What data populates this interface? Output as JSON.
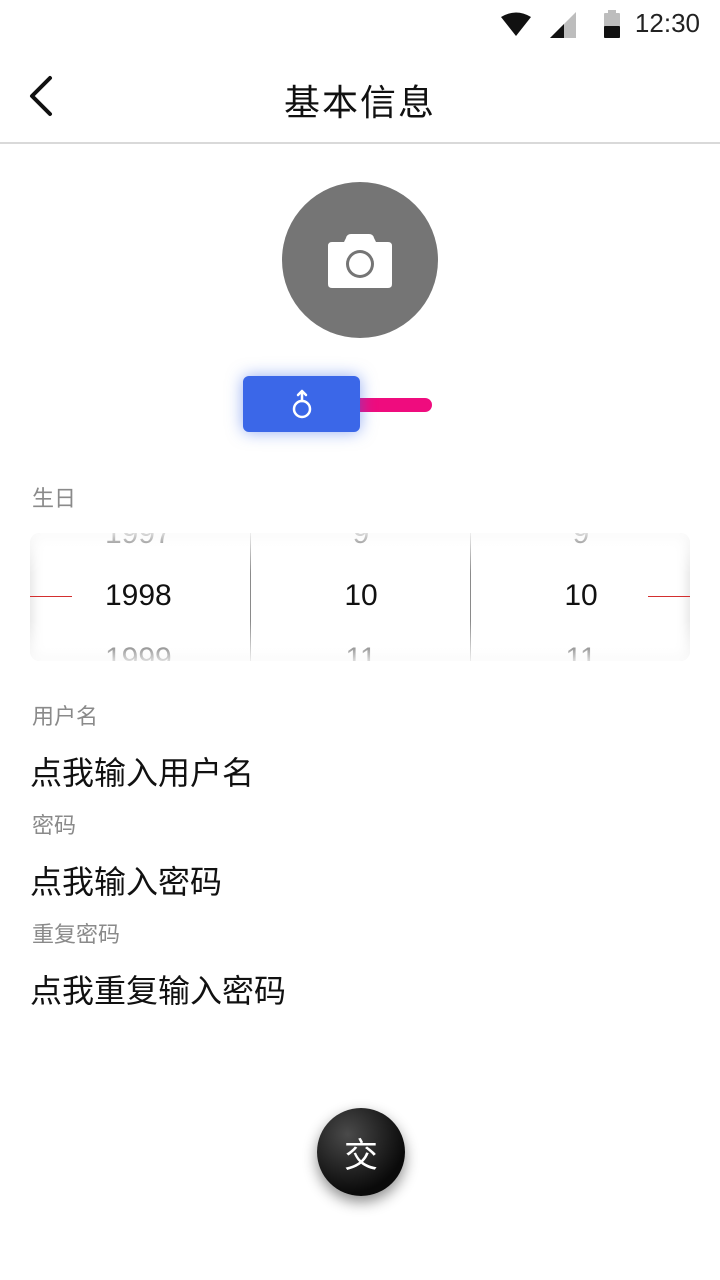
{
  "status_bar": {
    "time": "12:30"
  },
  "header": {
    "title": "基本信息"
  },
  "gender": {
    "male_symbol": "♂"
  },
  "birthday": {
    "label": "生日",
    "year": {
      "prev": "1997",
      "current": "1998",
      "next": "1999"
    },
    "month": {
      "prev": "9",
      "current": "10",
      "next": "11"
    },
    "day": {
      "prev": "9",
      "current": "10",
      "next": "11"
    }
  },
  "username": {
    "label": "用户名",
    "placeholder": "点我输入用户名"
  },
  "password": {
    "label": "密码",
    "placeholder": "点我输入密码"
  },
  "repeat_password": {
    "label": "重复密码",
    "placeholder": "点我重复输入密码"
  },
  "submit": {
    "label": "交"
  },
  "colors": {
    "accent_blue": "#3b67e8",
    "accent_pink": "#ef0c7e",
    "avatar_gray": "#757575"
  }
}
